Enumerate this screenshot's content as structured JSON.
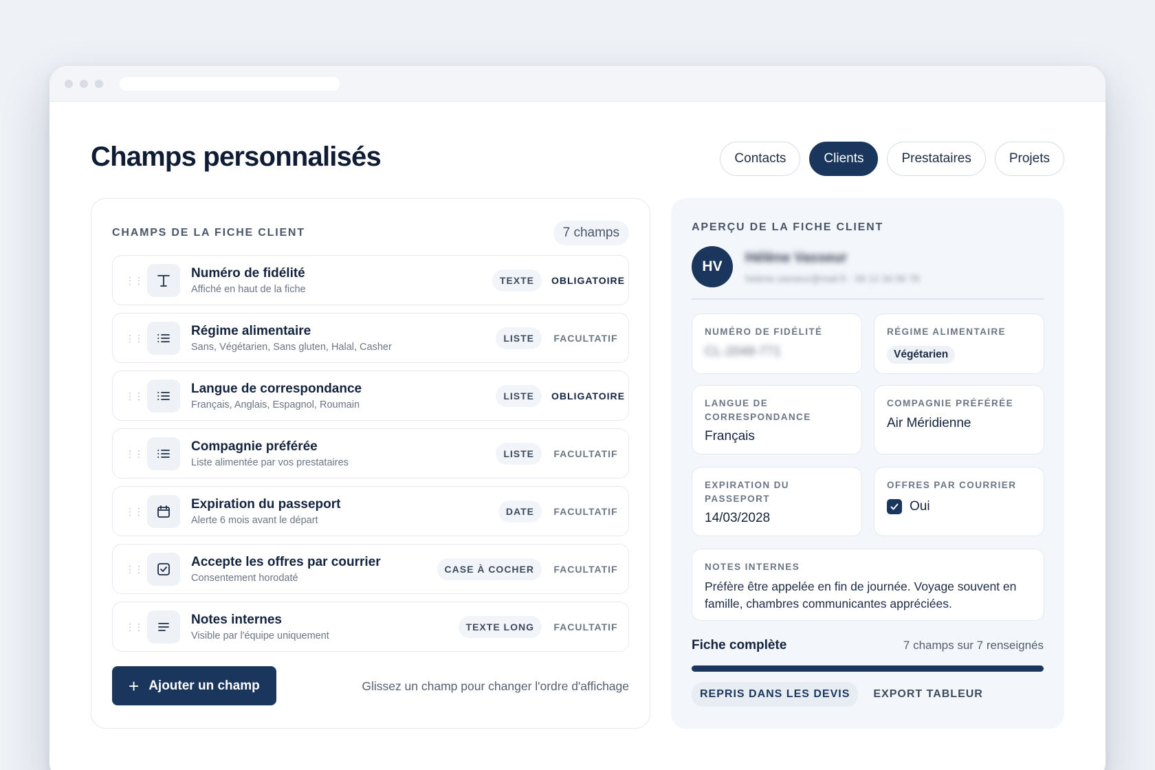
{
  "page": {
    "title": "Champs personnalisés"
  },
  "tabs": [
    {
      "label": "Contacts",
      "active": false
    },
    {
      "label": "Clients",
      "active": true
    },
    {
      "label": "Prestataires",
      "active": false
    },
    {
      "label": "Projets",
      "active": false
    }
  ],
  "fields_panel": {
    "title": "CHAMPS DE LA FICHE CLIENT",
    "count": "7 champs",
    "items": [
      {
        "icon": "text-icon",
        "name": "Numéro de fidélité",
        "sub": "Affiché en haut de la fiche",
        "type": "TEXTE",
        "requirement": "OBLIGATOIRE",
        "required": true
      },
      {
        "icon": "list-icon",
        "name": "Régime alimentaire",
        "sub": "Sans, Végétarien, Sans gluten, Halal, Casher",
        "type": "LISTE",
        "requirement": "FACULTATIF",
        "required": false
      },
      {
        "icon": "list-icon",
        "name": "Langue de correspondance",
        "sub": "Français, Anglais, Espagnol, Roumain",
        "type": "LISTE",
        "requirement": "OBLIGATOIRE",
        "required": true
      },
      {
        "icon": "list-icon",
        "name": "Compagnie préférée",
        "sub": "Liste alimentée par vos prestataires",
        "type": "LISTE",
        "requirement": "FACULTATIF",
        "required": false
      },
      {
        "icon": "calendar-icon",
        "name": "Expiration du passeport",
        "sub": "Alerte 6 mois avant le départ",
        "type": "DATE",
        "requirement": "FACULTATIF",
        "required": false
      },
      {
        "icon": "checkbox-icon",
        "name": "Accepte les offres par courrier",
        "sub": "Consentement horodaté",
        "type": "CASE À COCHER",
        "requirement": "FACULTATIF",
        "required": false
      },
      {
        "icon": "paragraph-icon",
        "name": "Notes internes",
        "sub": "Visible par l'équipe uniquement",
        "type": "TEXTE LONG",
        "requirement": "FACULTATIF",
        "required": false
      }
    ],
    "add_button": "Ajouter un champ",
    "drag_hint": "Glissez un champ pour changer l'ordre d'affichage"
  },
  "preview": {
    "title": "APERÇU DE LA FICHE CLIENT",
    "client": {
      "initials": "HV",
      "name": "Hélène Vasseur",
      "contact": "helene.vasseur@mail.fr · 06 12 34 56 78"
    },
    "cards": {
      "loyalty": {
        "label": "NUMÉRO DE FIDÉLITÉ",
        "value": "CL-2048-771"
      },
      "diet": {
        "label": "RÉGIME ALIMENTAIRE",
        "value": "Végétarien"
      },
      "language": {
        "label": "LANGUE DE CORRESPONDANCE",
        "value": "Français"
      },
      "airline": {
        "label": "COMPAGNIE PRÉFÉRÉE",
        "value": "Air Méridienne"
      },
      "passport": {
        "label": "EXPIRATION DU PASSEPORT",
        "value": "14/03/2028"
      },
      "offers": {
        "label": "OFFRES PAR COURRIER",
        "value": "Oui",
        "checked": true
      },
      "notes": {
        "label": "NOTES INTERNES",
        "value": "Préfère être appelée en fin de journée. Voyage souvent en famille, chambres communicantes appréciées."
      }
    },
    "completion": {
      "label": "Fiche complète",
      "count": "7 champs sur 7 renseignés",
      "progress": 1.0
    },
    "actions": [
      "REPRIS DANS LES DEVIS",
      "EXPORT TABLEUR"
    ]
  },
  "colors": {
    "primary": "#1a365d",
    "background": "#eef1f6",
    "panel": "#f3f6fa"
  }
}
